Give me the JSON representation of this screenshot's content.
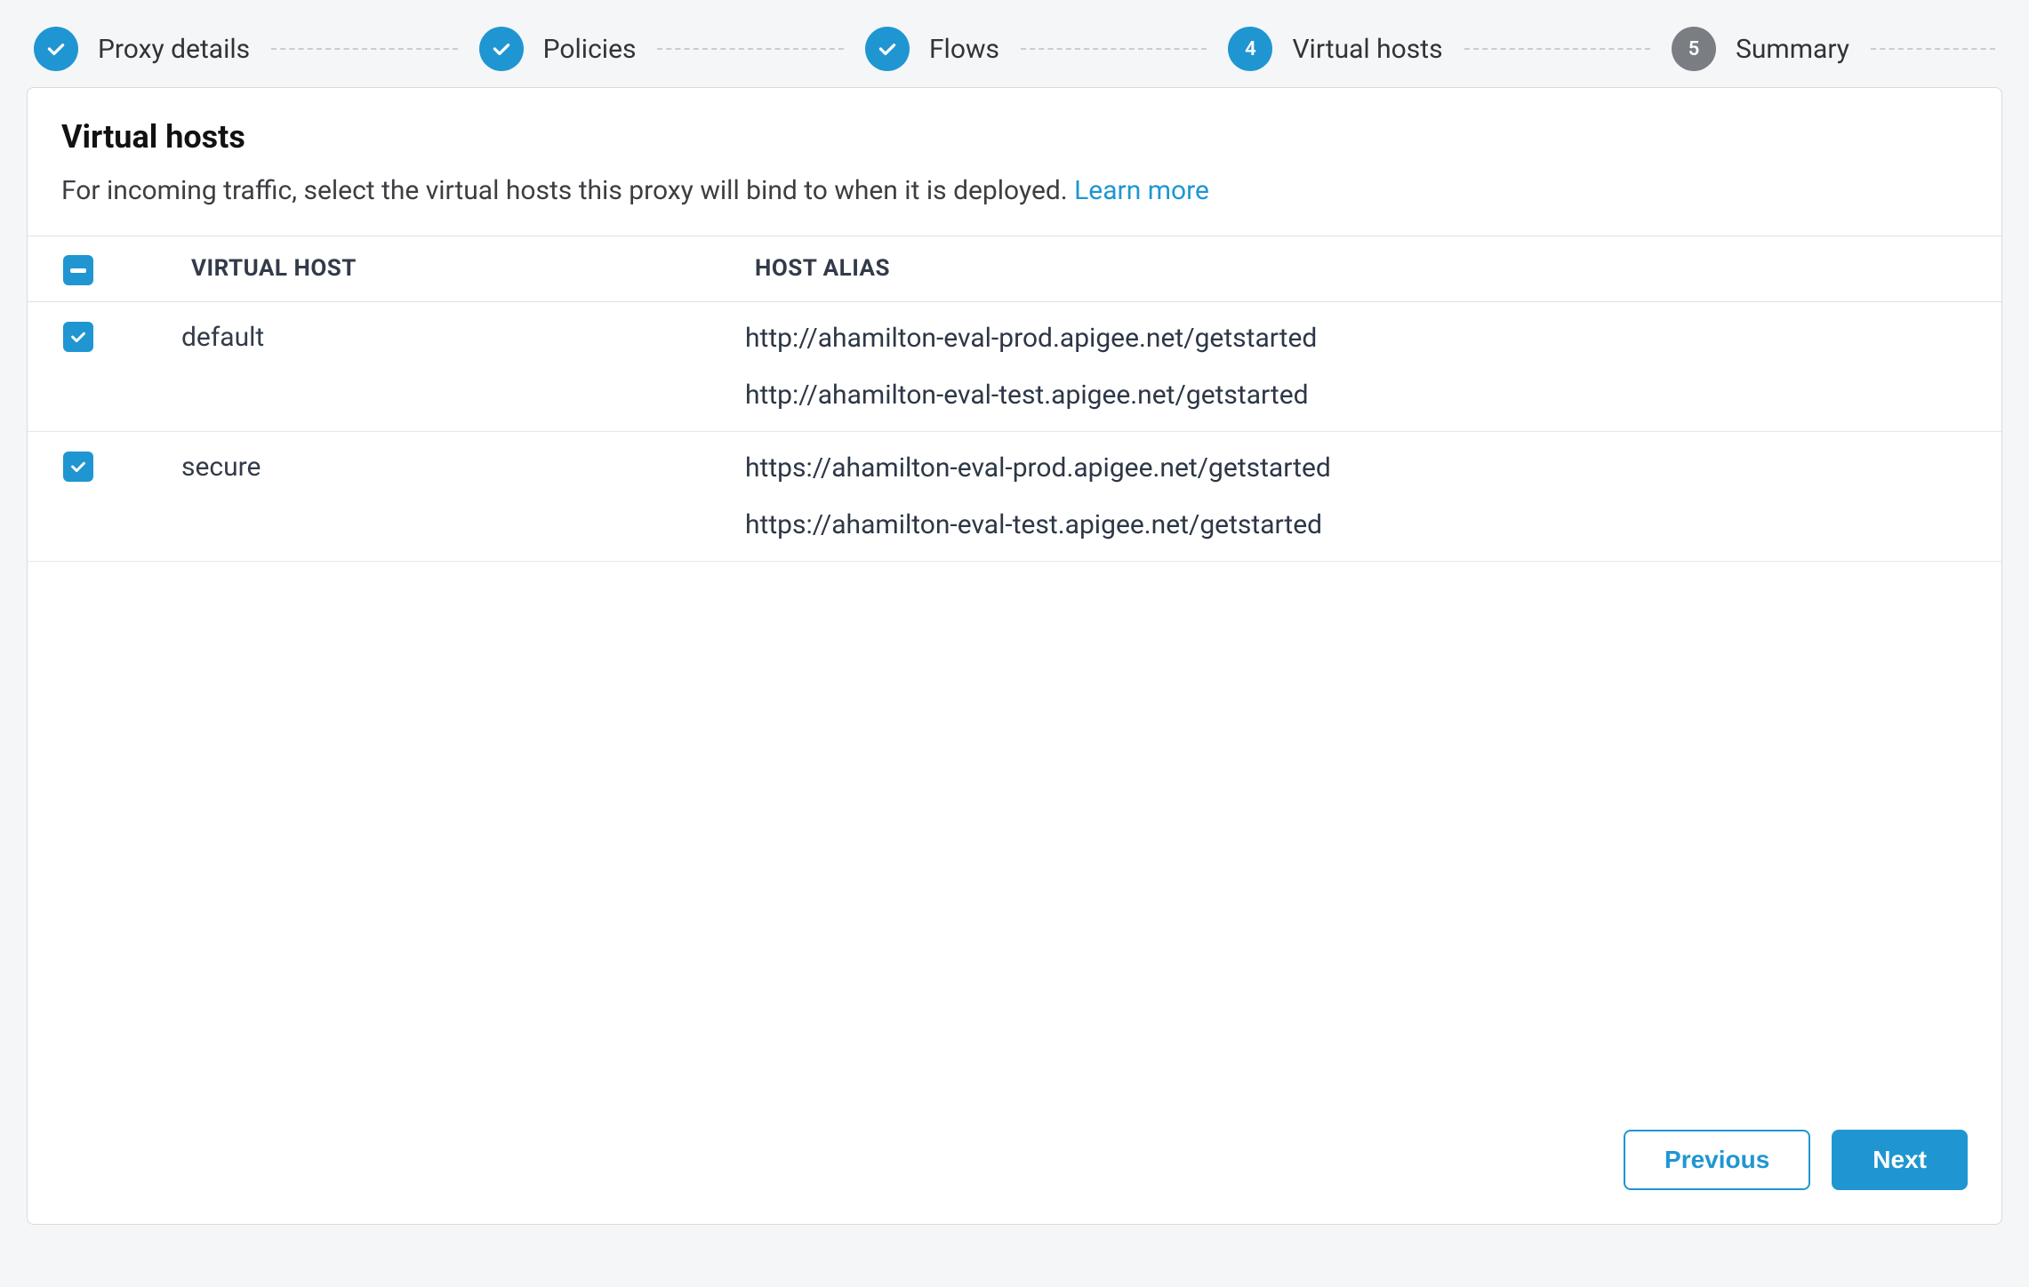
{
  "stepper": {
    "steps": [
      {
        "label": "Proxy details",
        "state": "done"
      },
      {
        "label": "Policies",
        "state": "done"
      },
      {
        "label": "Flows",
        "state": "done"
      },
      {
        "label": "Virtual hosts",
        "state": "active",
        "number": "4"
      },
      {
        "label": "Summary",
        "state": "pending",
        "number": "5"
      }
    ]
  },
  "card": {
    "title": "Virtual hosts",
    "description": "For incoming traffic, select the virtual hosts this proxy will bind to when it is deployed.",
    "learn_more": "Learn more"
  },
  "table": {
    "select_all_state": "indeterminate",
    "columns": {
      "virtual_host": "VIRTUAL HOST",
      "host_alias": "HOST ALIAS"
    },
    "rows": [
      {
        "checked": true,
        "name": "default",
        "aliases": [
          "http://ahamilton-eval-prod.apigee.net/getstarted",
          "http://ahamilton-eval-test.apigee.net/getstarted"
        ]
      },
      {
        "checked": true,
        "name": "secure",
        "aliases": [
          "https://ahamilton-eval-prod.apigee.net/getstarted",
          "https://ahamilton-eval-test.apigee.net/getstarted"
        ]
      }
    ]
  },
  "footer": {
    "previous": "Previous",
    "next": "Next"
  }
}
